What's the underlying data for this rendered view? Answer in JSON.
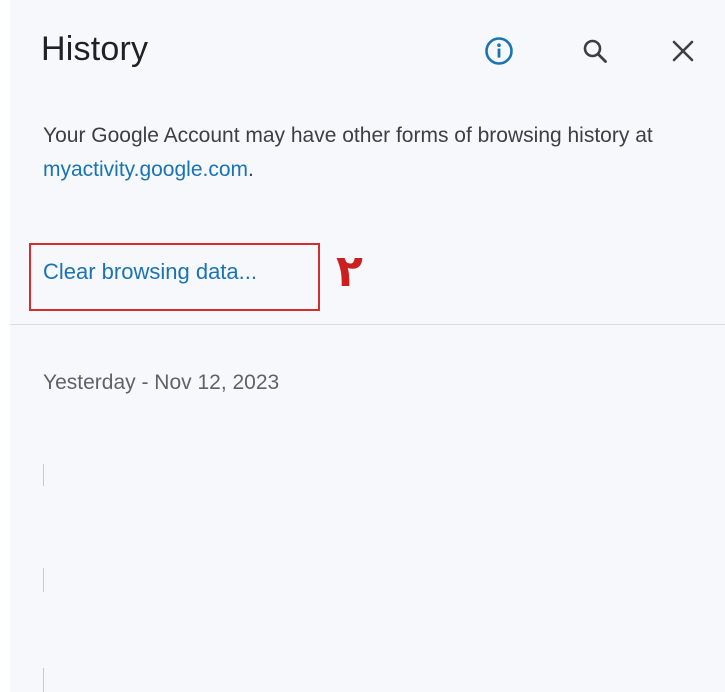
{
  "history_panel": {
    "title": "History",
    "toolbar": {
      "info_icon": "info-circle-icon",
      "search_icon": "search-icon",
      "close_icon": "close-icon",
      "accent_color": "#1a73b4"
    },
    "account_notice": {
      "text_before_link": "Your Google Account may have other forms of browsing history at ",
      "link_text": "myactivity.google.com",
      "text_after_link": "."
    },
    "clear_browsing_data_label": "Clear browsing data...",
    "annotation": {
      "step_number": "۲",
      "color": "#d32f2f"
    },
    "history_groups": [
      {
        "date_label": "Yesterday - Nov 12, 2023"
      }
    ]
  }
}
